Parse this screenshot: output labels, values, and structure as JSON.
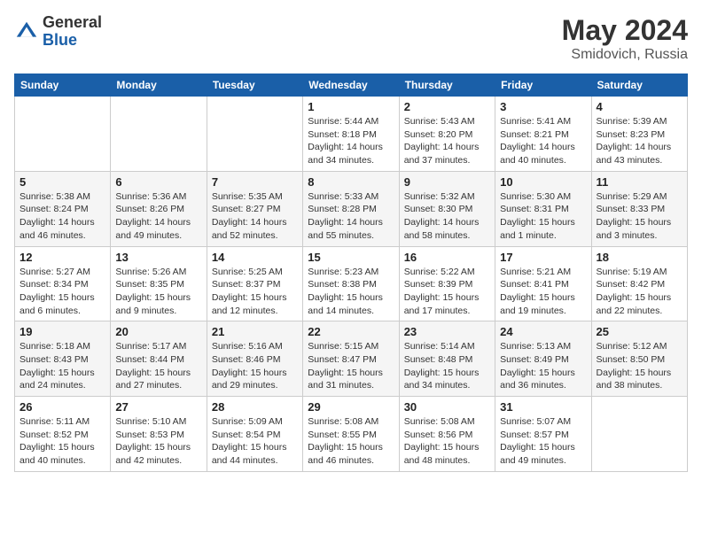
{
  "header": {
    "logo_general": "General",
    "logo_blue": "Blue",
    "month_title": "May 2024",
    "location": "Smidovich, Russia"
  },
  "days_of_week": [
    "Sunday",
    "Monday",
    "Tuesday",
    "Wednesday",
    "Thursday",
    "Friday",
    "Saturday"
  ],
  "weeks": [
    [
      {
        "day": "",
        "info": ""
      },
      {
        "day": "",
        "info": ""
      },
      {
        "day": "",
        "info": ""
      },
      {
        "day": "1",
        "info": "Sunrise: 5:44 AM\nSunset: 8:18 PM\nDaylight: 14 hours and 34 minutes."
      },
      {
        "day": "2",
        "info": "Sunrise: 5:43 AM\nSunset: 8:20 PM\nDaylight: 14 hours and 37 minutes."
      },
      {
        "day": "3",
        "info": "Sunrise: 5:41 AM\nSunset: 8:21 PM\nDaylight: 14 hours and 40 minutes."
      },
      {
        "day": "4",
        "info": "Sunrise: 5:39 AM\nSunset: 8:23 PM\nDaylight: 14 hours and 43 minutes."
      }
    ],
    [
      {
        "day": "5",
        "info": "Sunrise: 5:38 AM\nSunset: 8:24 PM\nDaylight: 14 hours and 46 minutes."
      },
      {
        "day": "6",
        "info": "Sunrise: 5:36 AM\nSunset: 8:26 PM\nDaylight: 14 hours and 49 minutes."
      },
      {
        "day": "7",
        "info": "Sunrise: 5:35 AM\nSunset: 8:27 PM\nDaylight: 14 hours and 52 minutes."
      },
      {
        "day": "8",
        "info": "Sunrise: 5:33 AM\nSunset: 8:28 PM\nDaylight: 14 hours and 55 minutes."
      },
      {
        "day": "9",
        "info": "Sunrise: 5:32 AM\nSunset: 8:30 PM\nDaylight: 14 hours and 58 minutes."
      },
      {
        "day": "10",
        "info": "Sunrise: 5:30 AM\nSunset: 8:31 PM\nDaylight: 15 hours and 1 minute."
      },
      {
        "day": "11",
        "info": "Sunrise: 5:29 AM\nSunset: 8:33 PM\nDaylight: 15 hours and 3 minutes."
      }
    ],
    [
      {
        "day": "12",
        "info": "Sunrise: 5:27 AM\nSunset: 8:34 PM\nDaylight: 15 hours and 6 minutes."
      },
      {
        "day": "13",
        "info": "Sunrise: 5:26 AM\nSunset: 8:35 PM\nDaylight: 15 hours and 9 minutes."
      },
      {
        "day": "14",
        "info": "Sunrise: 5:25 AM\nSunset: 8:37 PM\nDaylight: 15 hours and 12 minutes."
      },
      {
        "day": "15",
        "info": "Sunrise: 5:23 AM\nSunset: 8:38 PM\nDaylight: 15 hours and 14 minutes."
      },
      {
        "day": "16",
        "info": "Sunrise: 5:22 AM\nSunset: 8:39 PM\nDaylight: 15 hours and 17 minutes."
      },
      {
        "day": "17",
        "info": "Sunrise: 5:21 AM\nSunset: 8:41 PM\nDaylight: 15 hours and 19 minutes."
      },
      {
        "day": "18",
        "info": "Sunrise: 5:19 AM\nSunset: 8:42 PM\nDaylight: 15 hours and 22 minutes."
      }
    ],
    [
      {
        "day": "19",
        "info": "Sunrise: 5:18 AM\nSunset: 8:43 PM\nDaylight: 15 hours and 24 minutes."
      },
      {
        "day": "20",
        "info": "Sunrise: 5:17 AM\nSunset: 8:44 PM\nDaylight: 15 hours and 27 minutes."
      },
      {
        "day": "21",
        "info": "Sunrise: 5:16 AM\nSunset: 8:46 PM\nDaylight: 15 hours and 29 minutes."
      },
      {
        "day": "22",
        "info": "Sunrise: 5:15 AM\nSunset: 8:47 PM\nDaylight: 15 hours and 31 minutes."
      },
      {
        "day": "23",
        "info": "Sunrise: 5:14 AM\nSunset: 8:48 PM\nDaylight: 15 hours and 34 minutes."
      },
      {
        "day": "24",
        "info": "Sunrise: 5:13 AM\nSunset: 8:49 PM\nDaylight: 15 hours and 36 minutes."
      },
      {
        "day": "25",
        "info": "Sunrise: 5:12 AM\nSunset: 8:50 PM\nDaylight: 15 hours and 38 minutes."
      }
    ],
    [
      {
        "day": "26",
        "info": "Sunrise: 5:11 AM\nSunset: 8:52 PM\nDaylight: 15 hours and 40 minutes."
      },
      {
        "day": "27",
        "info": "Sunrise: 5:10 AM\nSunset: 8:53 PM\nDaylight: 15 hours and 42 minutes."
      },
      {
        "day": "28",
        "info": "Sunrise: 5:09 AM\nSunset: 8:54 PM\nDaylight: 15 hours and 44 minutes."
      },
      {
        "day": "29",
        "info": "Sunrise: 5:08 AM\nSunset: 8:55 PM\nDaylight: 15 hours and 46 minutes."
      },
      {
        "day": "30",
        "info": "Sunrise: 5:08 AM\nSunset: 8:56 PM\nDaylight: 15 hours and 48 minutes."
      },
      {
        "day": "31",
        "info": "Sunrise: 5:07 AM\nSunset: 8:57 PM\nDaylight: 15 hours and 49 minutes."
      },
      {
        "day": "",
        "info": ""
      }
    ]
  ]
}
